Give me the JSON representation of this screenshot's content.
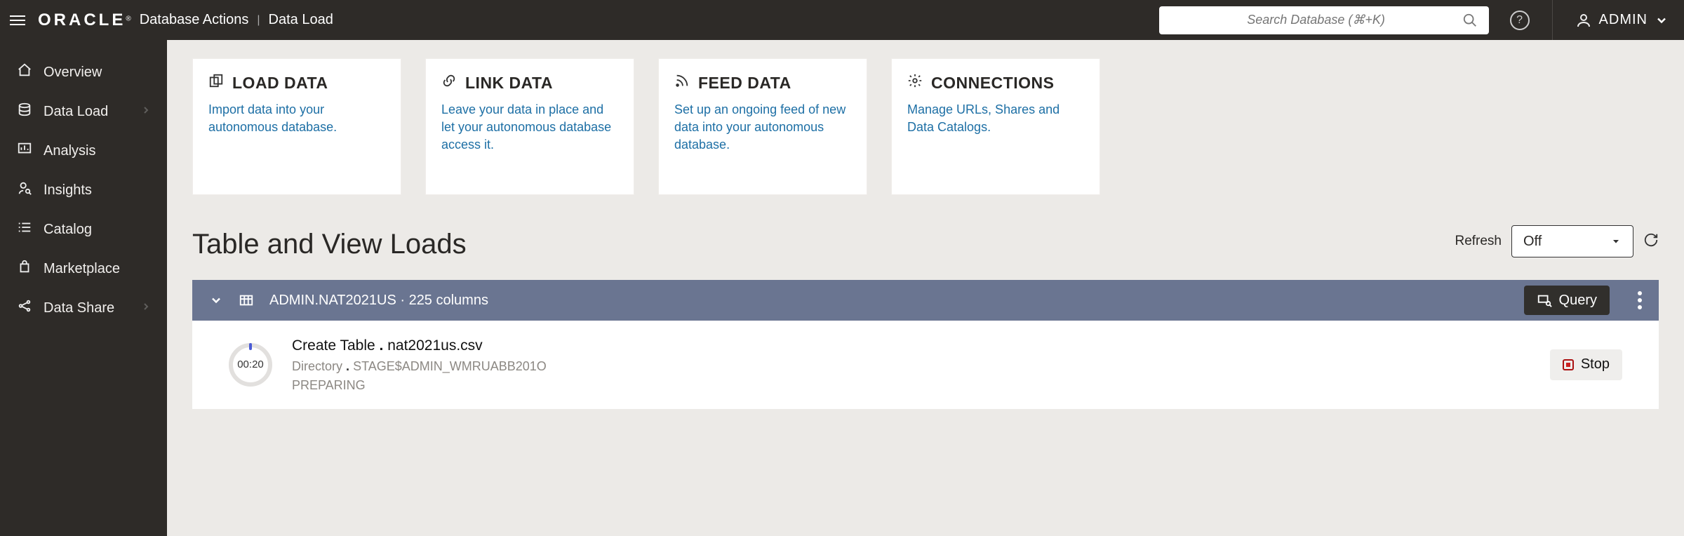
{
  "header": {
    "brand": "ORACLE",
    "subtitle1": "Database Actions",
    "subtitle2": "Data Load",
    "search_placeholder": "Search Database (⌘+K)",
    "user": "ADMIN"
  },
  "sidebar": {
    "items": [
      {
        "label": "Overview",
        "icon": "home"
      },
      {
        "label": "Data Load",
        "icon": "dataload",
        "chevron": true
      },
      {
        "label": "Analysis",
        "icon": "analysis"
      },
      {
        "label": "Insights",
        "icon": "insights"
      },
      {
        "label": "Catalog",
        "icon": "catalog"
      },
      {
        "label": "Marketplace",
        "icon": "marketplace"
      },
      {
        "label": "Data Share",
        "icon": "share",
        "chevron": true
      }
    ]
  },
  "cards": [
    {
      "title": "LOAD DATA",
      "desc": "Import data into your autonomous database."
    },
    {
      "title": "LINK DATA",
      "desc": "Leave your data in place and let your autonomous database access it."
    },
    {
      "title": "FEED DATA",
      "desc": "Set up an ongoing feed of new data into your autonomous database."
    },
    {
      "title": "CONNECTIONS",
      "desc": "Manage URLs, Shares and Data Catalogs."
    }
  ],
  "section": {
    "title": "Table and View Loads",
    "refresh_label": "Refresh",
    "refresh_value": "Off"
  },
  "load": {
    "header_text": "ADMIN.NAT2021US · 225 columns",
    "query_label": "Query",
    "timer": "00:20",
    "line1a": "Create Table",
    "line1b": "nat2021us.csv",
    "line2a": "Directory",
    "line2b": "STAGE$ADMIN_WMRUABB201O",
    "status": "PREPARING",
    "stop_label": "Stop"
  }
}
